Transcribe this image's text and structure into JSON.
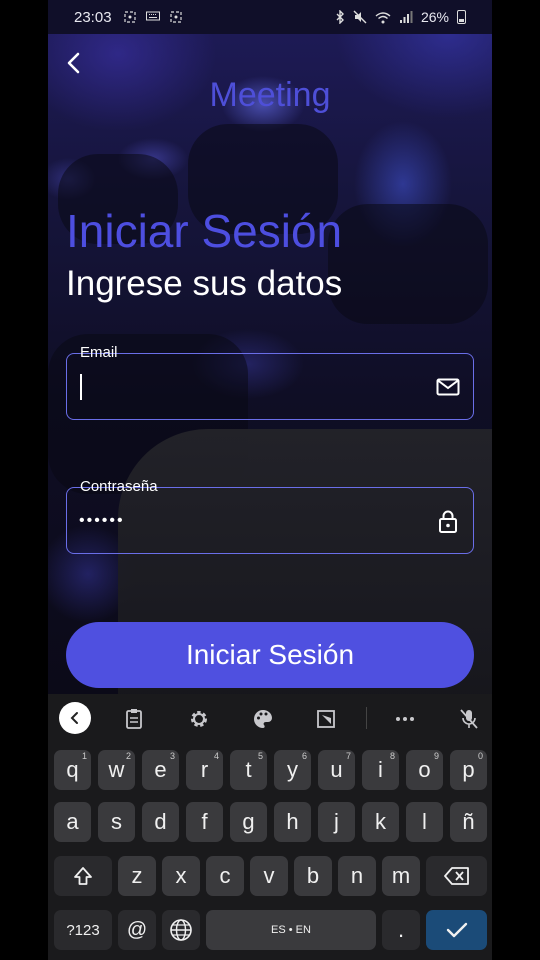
{
  "status_bar": {
    "time": "23:03",
    "battery": "26%",
    "left_icons": [
      "screenshot-icon",
      "keyboard-icon",
      "screenshot-icon"
    ],
    "right_icons": [
      "bluetooth-icon",
      "mute-icon",
      "wifi-icon",
      "signal-icon",
      "battery-icon"
    ]
  },
  "header": {
    "app_name": "Meeting",
    "back_icon": "chevron-left-icon"
  },
  "login": {
    "title": "Iniciar Sesión",
    "subtitle": "Ingrese sus datos",
    "email_label": "Email",
    "email_value": "",
    "password_label": "Contraseña",
    "password_value": "••••••",
    "button_label": "Iniciar Sesión"
  },
  "colors": {
    "accent": "#4f50e0",
    "field_border": "#6a6ee8",
    "keyboard_bg": "#1a1a1c",
    "key_bg": "#3a3a3d",
    "enter_key": "#1b4b78"
  },
  "keyboard": {
    "toolbar_icons": [
      "chevron-left-icon",
      "clipboard-icon",
      "gear-icon",
      "palette-icon",
      "resize-icon",
      "more-icon",
      "mic-off-icon"
    ],
    "row1": [
      {
        "k": "q",
        "h": "1"
      },
      {
        "k": "w",
        "h": "2"
      },
      {
        "k": "e",
        "h": "3"
      },
      {
        "k": "r",
        "h": "4"
      },
      {
        "k": "t",
        "h": "5"
      },
      {
        "k": "y",
        "h": "6"
      },
      {
        "k": "u",
        "h": "7"
      },
      {
        "k": "i",
        "h": "8"
      },
      {
        "k": "o",
        "h": "9"
      },
      {
        "k": "p",
        "h": "0"
      }
    ],
    "row2": [
      "a",
      "s",
      "d",
      "f",
      "g",
      "h",
      "j",
      "k",
      "l",
      "ñ"
    ],
    "row3": [
      "z",
      "x",
      "c",
      "v",
      "b",
      "n",
      "m"
    ],
    "symbols_label": "?123",
    "at_label": "@",
    "space_label": "ES • EN",
    "period_label": "."
  }
}
